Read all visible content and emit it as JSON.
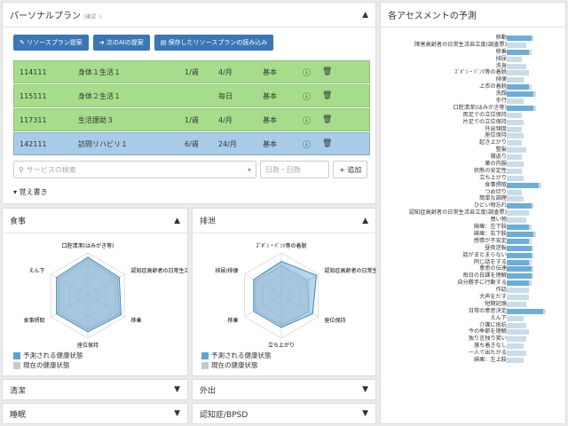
{
  "plan": {
    "title": "パーソナルプラン",
    "subtitle": "(確認 :)",
    "buttons": [
      "リソースプラン提案",
      "次のAIの提案",
      "保存したリソースプランの読み込み"
    ],
    "rows": [
      {
        "code": "114111",
        "name": "身体１生活１",
        "freq": "1/週",
        "count": "4/月",
        "type": "基本",
        "color": "green"
      },
      {
        "code": "115111",
        "name": "身体２生活１",
        "freq": "",
        "count": "毎日",
        "type": "基本",
        "color": "green"
      },
      {
        "code": "117311",
        "name": "生活援助３",
        "freq": "1/週",
        "count": "4/月",
        "type": "基本",
        "color": "green"
      },
      {
        "code": "142111",
        "name": "訪問リハビリ１",
        "freq": "6/週",
        "count": "24/月",
        "type": "基本",
        "color": "blue"
      }
    ],
    "search_placeholder": "サービスの検索",
    "days_placeholder": "日数・回数",
    "add_label": "+ 追加",
    "memo_label": "覚え書き"
  },
  "colors": {
    "accent": "#3a77b5",
    "green_row": "#a6dd8b",
    "blue_row": "#a8cbe8",
    "predicted": "#5ca4d6",
    "current": "#c8c8c8"
  },
  "meal": {
    "title": "食事",
    "axes": [
      "口腔清潔(はみがき等)",
      "認知症高齢者の日常生活自立度",
      "移乗",
      "座位保持",
      "食事摂取",
      "えん下"
    ],
    "predicted": [
      0.9,
      0.85,
      0.9,
      0.85,
      0.85,
      0.85
    ],
    "current": [
      0.85,
      0.8,
      0.85,
      0.8,
      0.8,
      0.8
    ]
  },
  "excretion": {
    "title": "排泄",
    "axes": [
      "ｽﾞﾎﾞﾝ・ﾊﾟﾝﾂ等の着脱",
      "認知症高齢者の日常生活自立度",
      "座位保持",
      "立ち上がり",
      "移乗",
      "排尿/排便"
    ],
    "predicted": [
      0.8,
      0.95,
      0.85,
      0.75,
      0.75,
      0.75
    ],
    "current": [
      0.7,
      0.7,
      0.75,
      0.7,
      0.7,
      0.7
    ]
  },
  "legend": {
    "predicted": "予測される健康状態",
    "current": "現在の健康状態"
  },
  "collapsed": [
    "清潔",
    "外出",
    "睡眠",
    "認知症/BPSD"
  ],
  "assessment": {
    "title": "各アセスメントの予測",
    "items": [
      {
        "label": "移動",
        "pred": 0.5,
        "cur": 0.55
      },
      {
        "label": "障害高齢者の日常生活自立度(調査票)",
        "pred": 0.3,
        "cur": 0.4
      },
      {
        "label": "移乗",
        "pred": 0.45,
        "cur": 0.5
      },
      {
        "label": "排尿",
        "pred": 0.25,
        "cur": 0.3
      },
      {
        "label": "洗身",
        "pred": 0.35,
        "cur": 0.4
      },
      {
        "label": "ｽﾞﾎﾞﾝ・ﾊﾟﾝﾂ等の着脱",
        "pred": 0.4,
        "cur": 0.45
      },
      {
        "label": "排便",
        "pred": 0.3,
        "cur": 0.35
      },
      {
        "label": "上衣の着脱",
        "pred": 0.45,
        "cur": 0.5
      },
      {
        "label": "洗顔",
        "pred": 0.55,
        "cur": 0.6
      },
      {
        "label": "歩行",
        "pred": 0.3,
        "cur": 0.35
      },
      {
        "label": "口腔清潔(はみがき等)",
        "pred": 0.55,
        "cur": 0.6
      },
      {
        "label": "両足での立位保持",
        "pred": 0.2,
        "cur": 0.3
      },
      {
        "label": "片足での立位保持",
        "pred": 0.25,
        "cur": 0.35
      },
      {
        "label": "外出頻度",
        "pred": 0.2,
        "cur": 0.3
      },
      {
        "label": "座位保持",
        "pred": 0.3,
        "cur": 0.35
      },
      {
        "label": "起き上がり",
        "pred": 0.25,
        "cur": 0.3
      },
      {
        "label": "整髪",
        "pred": 0.35,
        "cur": 0.4
      },
      {
        "label": "寝返り",
        "pred": 0.2,
        "cur": 0.3
      },
      {
        "label": "薬の内服",
        "pred": 0.3,
        "cur": 0.35
      },
      {
        "label": "状態の安定性",
        "pred": 0.25,
        "cur": 0.3
      },
      {
        "label": "立ち上がり",
        "pred": 0.3,
        "cur": 0.35
      },
      {
        "label": "食事摂取",
        "pred": 0.65,
        "cur": 0.7
      },
      {
        "label": "つめ切り",
        "pred": 0.25,
        "cur": 0.3
      },
      {
        "label": "簡単な調理",
        "pred": 0.3,
        "cur": 0.35
      },
      {
        "label": "ひどい物忘れ",
        "pred": 0.5,
        "cur": 0.55
      },
      {
        "label": "認知症高齢者の日常生活自立度(調査票)",
        "pred": 0.4,
        "cur": 0.45
      },
      {
        "label": "買い物",
        "pred": 0.35,
        "cur": 0.4
      },
      {
        "label": "麻痺：左下肢",
        "pred": 0.45,
        "cur": 0.5
      },
      {
        "label": "麻痺：右下肢",
        "pred": 0.55,
        "cur": 0.6
      },
      {
        "label": "感情が不安定",
        "pred": 0.45,
        "cur": 0.5
      },
      {
        "label": "昼夜逆転",
        "pred": 0.5,
        "cur": 0.55
      },
      {
        "label": "話がまとまらない",
        "pred": 0.5,
        "cur": 0.55
      },
      {
        "label": "同じ話をする",
        "pred": 0.45,
        "cur": 0.5
      },
      {
        "label": "意思の伝達",
        "pred": 0.5,
        "cur": 0.55
      },
      {
        "label": "毎日の日課を理解",
        "pred": 0.5,
        "cur": 0.55
      },
      {
        "label": "自分勝手に行動する",
        "pred": 0.45,
        "cur": 0.5
      },
      {
        "label": "作話",
        "pred": 0.4,
        "cur": 0.45
      },
      {
        "label": "大声をだす",
        "pred": 0.4,
        "cur": 0.45
      },
      {
        "label": "短期記憶",
        "pred": 0.35,
        "cur": 0.4
      },
      {
        "label": "日常の意思決定",
        "pred": 0.75,
        "cur": 0.8
      },
      {
        "label": "えん下",
        "pred": 0.3,
        "cur": 0.35
      },
      {
        "label": "介護に抵抗",
        "pred": 0.35,
        "cur": 0.4
      },
      {
        "label": "今の季節を理解",
        "pred": 0.4,
        "cur": 0.45
      },
      {
        "label": "独り言独り笑い",
        "pred": 0.35,
        "cur": 0.4
      },
      {
        "label": "落ち着きなし",
        "pred": 0.3,
        "cur": 0.35
      },
      {
        "label": "一人で出たがる",
        "pred": 0.35,
        "cur": 0.4
      },
      {
        "label": "麻痺：左上肢",
        "pred": 0.3,
        "cur": 0.35
      }
    ]
  }
}
